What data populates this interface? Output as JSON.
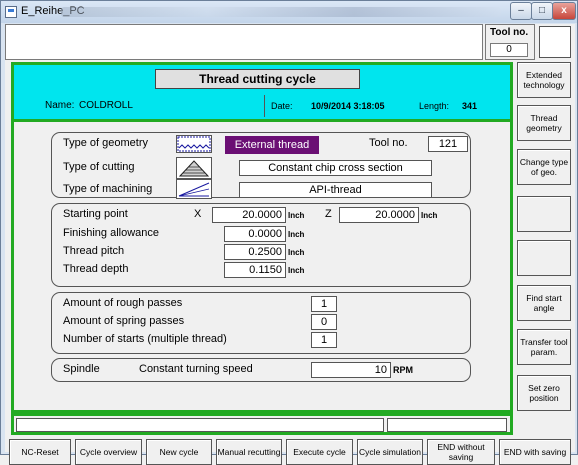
{
  "window": {
    "title": "E_Reihe_PC",
    "minimize": "–",
    "maximize": "□",
    "close": "x"
  },
  "top": {
    "tool_no_label": "Tool no.",
    "tool_no_value": "0"
  },
  "header": {
    "title": "Thread cutting cycle",
    "name_label": "Name:",
    "name_value": "COLDROLL",
    "date_label": "Date:",
    "date_value": "10/9/2014 3:18:05",
    "length_label": "Length:",
    "length_value": "341"
  },
  "geometry": {
    "type_geometry_label": "Type of geometry",
    "type_geometry_value": "External thread",
    "tool_no_label": "Tool no.",
    "tool_no_value": "121",
    "type_cutting_label": "Type of cutting",
    "type_cutting_value": "Constant chip cross section",
    "type_machining_label": "Type of machining",
    "type_machining_value": "API-thread"
  },
  "params": {
    "starting_point_label": "Starting point",
    "x_label": "X",
    "x_value": "20.0000",
    "z_label": "Z",
    "z_value": "20.0000",
    "finishing_label": "Finishing allowance",
    "finishing_value": "0.0000",
    "pitch_label": "Thread pitch",
    "pitch_value": "0.2500",
    "depth_label": "Thread depth",
    "depth_value": "0.1150",
    "unit": "Inch"
  },
  "passes": {
    "rough_label": "Amount of rough passes",
    "rough_value": "1",
    "spring_label": "Amount of spring passes",
    "spring_value": "0",
    "starts_label": "Number of starts (multiple thread)",
    "starts_value": "1"
  },
  "spindle": {
    "label": "Spindle",
    "mode": "Constant turning speed",
    "value": "10",
    "unit": "RPM"
  },
  "right_keys": [
    "Extended technology",
    "Thread geometry",
    "Change type of geo.",
    "",
    "",
    "Find start angle",
    "Transfer tool param.",
    "Set zero position"
  ],
  "bottom_keys": [
    "NC-Reset",
    "Cycle overview",
    "New cycle",
    "Manual recutting",
    "Execute cycle",
    "Cycle simulation",
    "END without saving",
    "END with saving"
  ],
  "colors": {
    "header_bg": "#00e5ee",
    "frame_green": "#22aa22",
    "thread_badge": "#6b0f74"
  }
}
